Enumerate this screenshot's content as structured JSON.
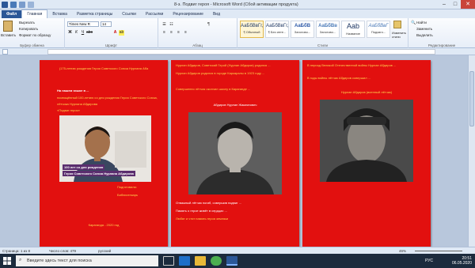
{
  "window": {
    "title": "8-з. Подвиг героя - Microsoft Word (Сбой активации продукта)"
  },
  "ribbon_tabs": [
    "Файл",
    "Главная",
    "Вставка",
    "Разметка страницы",
    "Ссылки",
    "Рассылки",
    "Рецензирование",
    "Вид"
  ],
  "clipboard": {
    "paste": "Вставить",
    "cut": "Вырезать",
    "copy": "Копировать",
    "format_painter": "Формат по образцу",
    "group": "Буфер обмена"
  },
  "font": {
    "name": "Times New R",
    "size": "14",
    "group": "Шрифт",
    "paragraph_group": "Абзац"
  },
  "styles": {
    "items": [
      {
        "preview": "АаБбВвГг,",
        "name": "¶ Обычный"
      },
      {
        "preview": "АаБбВвГг,",
        "name": "¶ Без инте..."
      },
      {
        "preview": "АаБбВ",
        "name": "Заголово..."
      },
      {
        "preview": "АаБбВв",
        "name": "Заголово..."
      },
      {
        "preview": "Aab",
        "name": "Название"
      },
      {
        "preview": "АаБбВвГ",
        "name": "Подзаго..."
      }
    ],
    "change": "Изменить стили",
    "group": "Стили"
  },
  "editing": {
    "find": "Найти",
    "replace": "Заменить",
    "select": "Выделить",
    "group": "Редактирование"
  },
  "pages": {
    "p1": {
      "header": "(175-летию рождения Героя Советского Союза Нурлана Аба",
      "intro": "На нашем языке в ...",
      "line1": "посвящённый 100-летию со дня рождения Героя Советского Союза,",
      "line2": "лётчика Нурлана Абдирова",
      "line3": "«Подвиг героя»",
      "banner1": "100 лет со дня рождения",
      "banner2": "Героя Советского Союза Нурлана Абдирова",
      "footer1": "Подготовила:",
      "footer2": "Библиотекарь",
      "date": "Караганда - 2020 год"
    },
    "p2": {
      "para1": "Нурлан Абдиров, Советский Герой (Нурлан Абдиров) родился ...",
      "para2": "Нурлан Абдиров родился в городе Каркаралы в 1923 году ...",
      "para3": "Совершенно лётчик окончил школу в Караганде ...",
      "para4": "Абдиров Нурлан Жакиянович",
      "caption1": "Отважный лётчик погиб, совершив подвиг ...",
      "caption2": "Память о герое живёт в сердцах ...",
      "caption3": "Любят и чтят память героя земляки"
    },
    "p3": {
      "para1": "В период Великой Отечественной войны Нурлан Абдиров ...",
      "para2": "В годы войны лётчик Абдиров совершил ...",
      "para3": "Нурлан Абдиров (военный лётчик)"
    }
  },
  "statusbar": {
    "page": "Страница: 1 из 8",
    "words": "Число слов: 479",
    "lang": "русский",
    "zoom": "46%"
  },
  "taskbar": {
    "search_placeholder": "Введите здесь текст для поиска",
    "lang": "РУС",
    "time": "20:51",
    "date": "06.05.2020"
  },
  "colors": {
    "page_bg": "#e2100f",
    "text_yellow": "#ffd54d",
    "ribbon_file": "#2b5797"
  }
}
